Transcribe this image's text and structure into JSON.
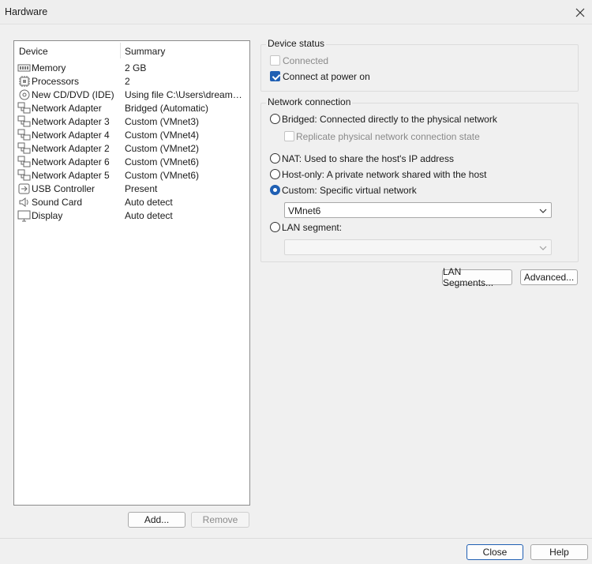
{
  "window": {
    "title": "Hardware"
  },
  "device_list": {
    "columns": {
      "device": "Device",
      "summary": "Summary"
    },
    "items": [
      {
        "icon": "memory-icon",
        "name": "Memory",
        "summary": "2 GB"
      },
      {
        "icon": "processor-icon",
        "name": "Processors",
        "summary": "2"
      },
      {
        "icon": "cd-dvd-icon",
        "name": "New CD/DVD (IDE)",
        "summary": "Using file C:\\Users\\dreamWe..."
      },
      {
        "icon": "network-adapter-icon",
        "name": "Network Adapter",
        "summary": "Bridged (Automatic)"
      },
      {
        "icon": "network-adapter-icon",
        "name": "Network Adapter 3",
        "summary": "Custom (VMnet3)"
      },
      {
        "icon": "network-adapter-icon",
        "name": "Network Adapter 4",
        "summary": "Custom (VMnet4)"
      },
      {
        "icon": "network-adapter-icon",
        "name": "Network Adapter 2",
        "summary": "Custom (VMnet2)"
      },
      {
        "icon": "network-adapter-icon",
        "name": "Network Adapter 6",
        "summary": "Custom (VMnet6)"
      },
      {
        "icon": "network-adapter-icon",
        "name": "Network Adapter 5",
        "summary": "Custom (VMnet6)"
      },
      {
        "icon": "usb-controller-icon",
        "name": "USB Controller",
        "summary": "Present"
      },
      {
        "icon": "sound-card-icon",
        "name": "Sound Card",
        "summary": "Auto detect"
      },
      {
        "icon": "display-icon",
        "name": "Display",
        "summary": "Auto detect"
      }
    ],
    "add_button": "Add...",
    "remove_button": "Remove"
  },
  "device_status": {
    "legend": "Device status",
    "connected": {
      "label": "Connected",
      "checked": false,
      "disabled": true
    },
    "connect_at_power_on": {
      "label": "Connect at power on",
      "checked": true
    }
  },
  "network_connection": {
    "legend": "Network connection",
    "bridged": "Bridged: Connected directly to the physical network",
    "replicate": "Replicate physical network connection state",
    "nat": "NAT: Used to share the host's IP address",
    "host_only": "Host-only: A private network shared with the host",
    "custom": "Custom: Specific virtual network",
    "custom_selected_value": "VMnet6",
    "lan_segment": "LAN segment:",
    "lan_segment_value": "",
    "selected": "custom"
  },
  "buttons": {
    "lan_segments": "LAN Segments...",
    "advanced": "Advanced...",
    "close": "Close",
    "help": "Help"
  },
  "colors": {
    "accent": "#1f5fb3",
    "list_border": "#8c8c8c"
  }
}
